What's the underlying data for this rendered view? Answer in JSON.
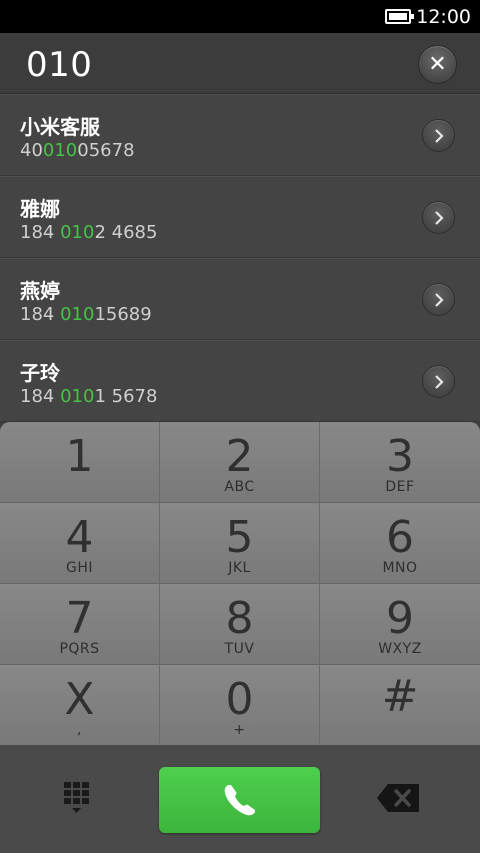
{
  "status_bar": {
    "time": "12:00",
    "battery_icon": "battery-icon"
  },
  "dialer": {
    "number": "010",
    "clear_icon": "close-icon",
    "clear_label": "✕"
  },
  "contacts": [
    {
      "name": "小米客服",
      "number_pre": "40",
      "number_match": "010",
      "number_post": "05678"
    },
    {
      "name": "雅娜",
      "number_pre": "184 ",
      "number_match": "010",
      "number_post": "2 4685"
    },
    {
      "name": "燕婷",
      "number_pre": "184 ",
      "number_match": "010",
      "number_post": "15689"
    },
    {
      "name": "子玲",
      "number_pre": "184 ",
      "number_match": "010",
      "number_post": "1 5678"
    }
  ],
  "highlight_color": "#46c346",
  "keypad": [
    {
      "digit": "1",
      "letters": ""
    },
    {
      "digit": "2",
      "letters": "ABC"
    },
    {
      "digit": "3",
      "letters": "DEF"
    },
    {
      "digit": "4",
      "letters": "GHI"
    },
    {
      "digit": "5",
      "letters": "JKL"
    },
    {
      "digit": "6",
      "letters": "MNO"
    },
    {
      "digit": "7",
      "letters": "PQRS"
    },
    {
      "digit": "8",
      "letters": "TUV"
    },
    {
      "digit": "9",
      "letters": "WXYZ"
    },
    {
      "digit": "X",
      "letters": ","
    },
    {
      "digit": "0",
      "letters": "+"
    },
    {
      "digit": "#",
      "letters": ""
    }
  ],
  "bottom_bar": {
    "keypad_toggle_icon": "dialpad-icon",
    "call_icon": "phone-icon",
    "call_color": "#45c445",
    "backspace_icon": "backspace-icon"
  }
}
